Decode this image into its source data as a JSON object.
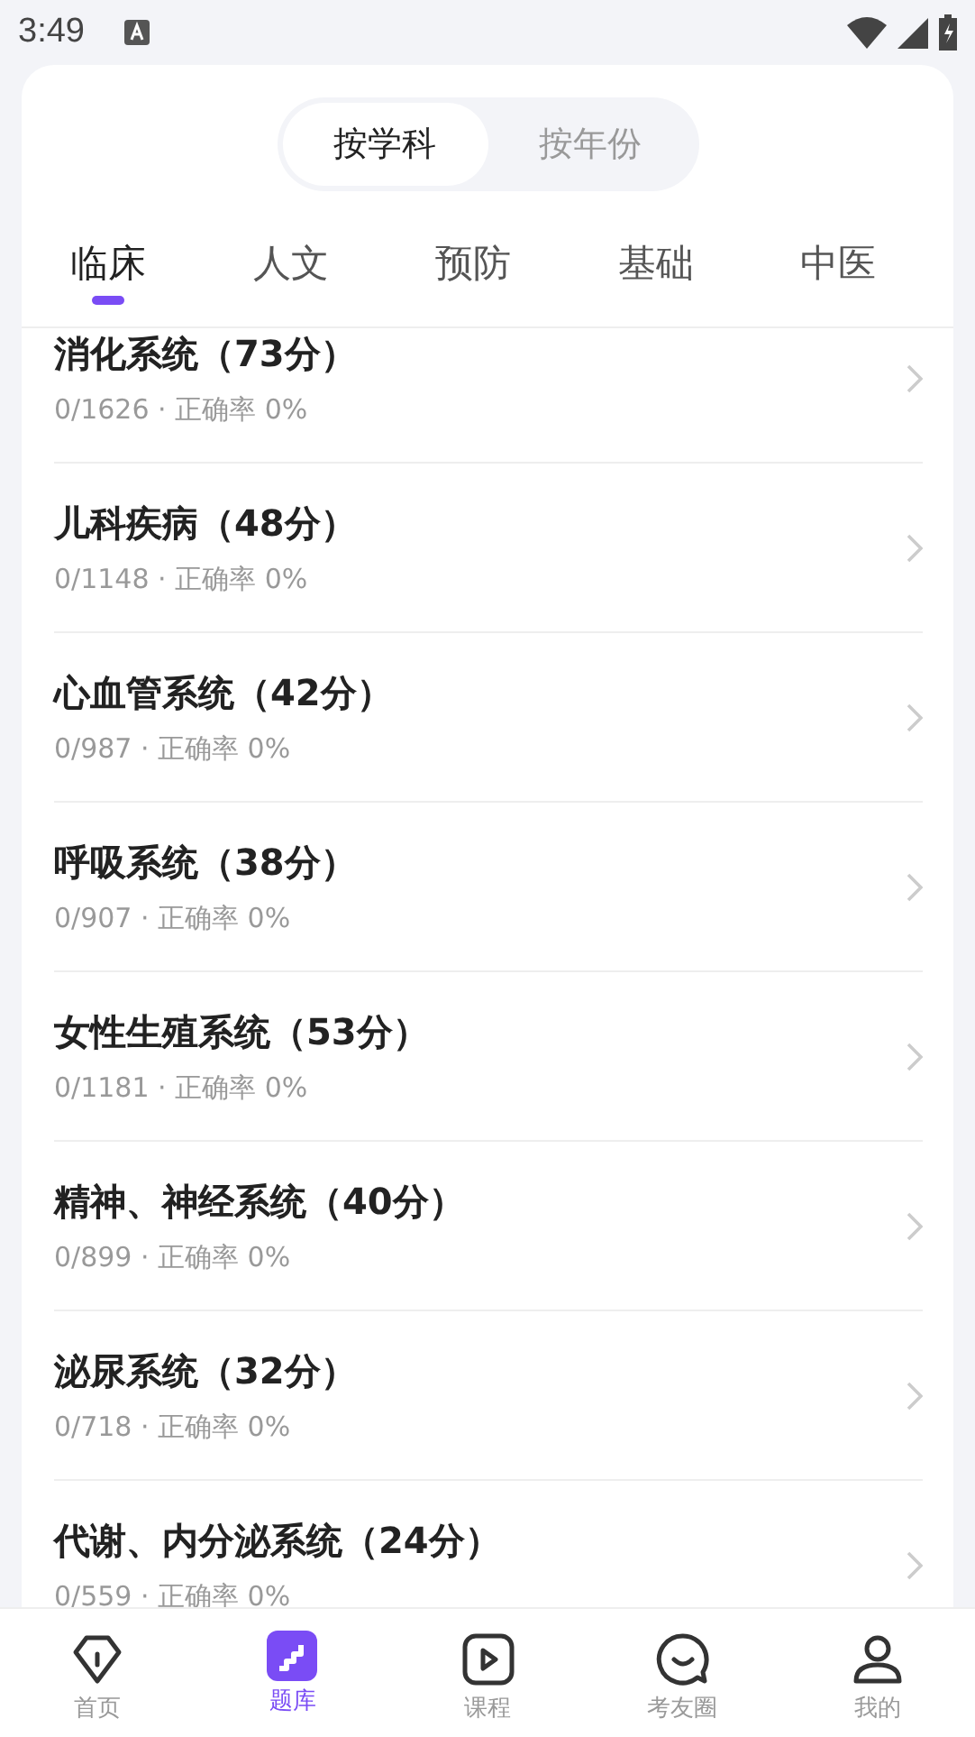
{
  "status_bar": {
    "time": "3:49"
  },
  "segments": [
    {
      "label": "按学科",
      "selected": true
    },
    {
      "label": "按年份",
      "selected": false
    }
  ],
  "tabs": [
    {
      "label": "临床",
      "selected": true
    },
    {
      "label": "人文",
      "selected": false
    },
    {
      "label": "预防",
      "selected": false
    },
    {
      "label": "基础",
      "selected": false
    },
    {
      "label": "中医",
      "selected": false
    }
  ],
  "subjects": [
    {
      "title": "消化系统（73分）",
      "progress": "0/1626 · 正确率 0%"
    },
    {
      "title": "儿科疾病（48分）",
      "progress": "0/1148 · 正确率 0%"
    },
    {
      "title": "心血管系统（42分）",
      "progress": "0/987 · 正确率 0%"
    },
    {
      "title": "呼吸系统（38分）",
      "progress": "0/907 · 正确率 0%"
    },
    {
      "title": "女性生殖系统（53分）",
      "progress": "0/1181 · 正确率 0%"
    },
    {
      "title": "精神、神经系统（40分）",
      "progress": "0/899 · 正确率 0%"
    },
    {
      "title": "泌尿系统（32分）",
      "progress": "0/718 · 正确率 0%"
    },
    {
      "title": "代谢、内分泌系统（24分）",
      "progress": "0/559 · 正确率 0%"
    }
  ],
  "bottom_nav": [
    {
      "label": "首页",
      "kind": "home",
      "selected": false
    },
    {
      "label": "题库",
      "kind": "bank",
      "selected": true
    },
    {
      "label": "课程",
      "kind": "course",
      "selected": false
    },
    {
      "label": "考友圈",
      "kind": "community",
      "selected": false
    },
    {
      "label": "我的",
      "kind": "profile",
      "selected": false
    }
  ]
}
